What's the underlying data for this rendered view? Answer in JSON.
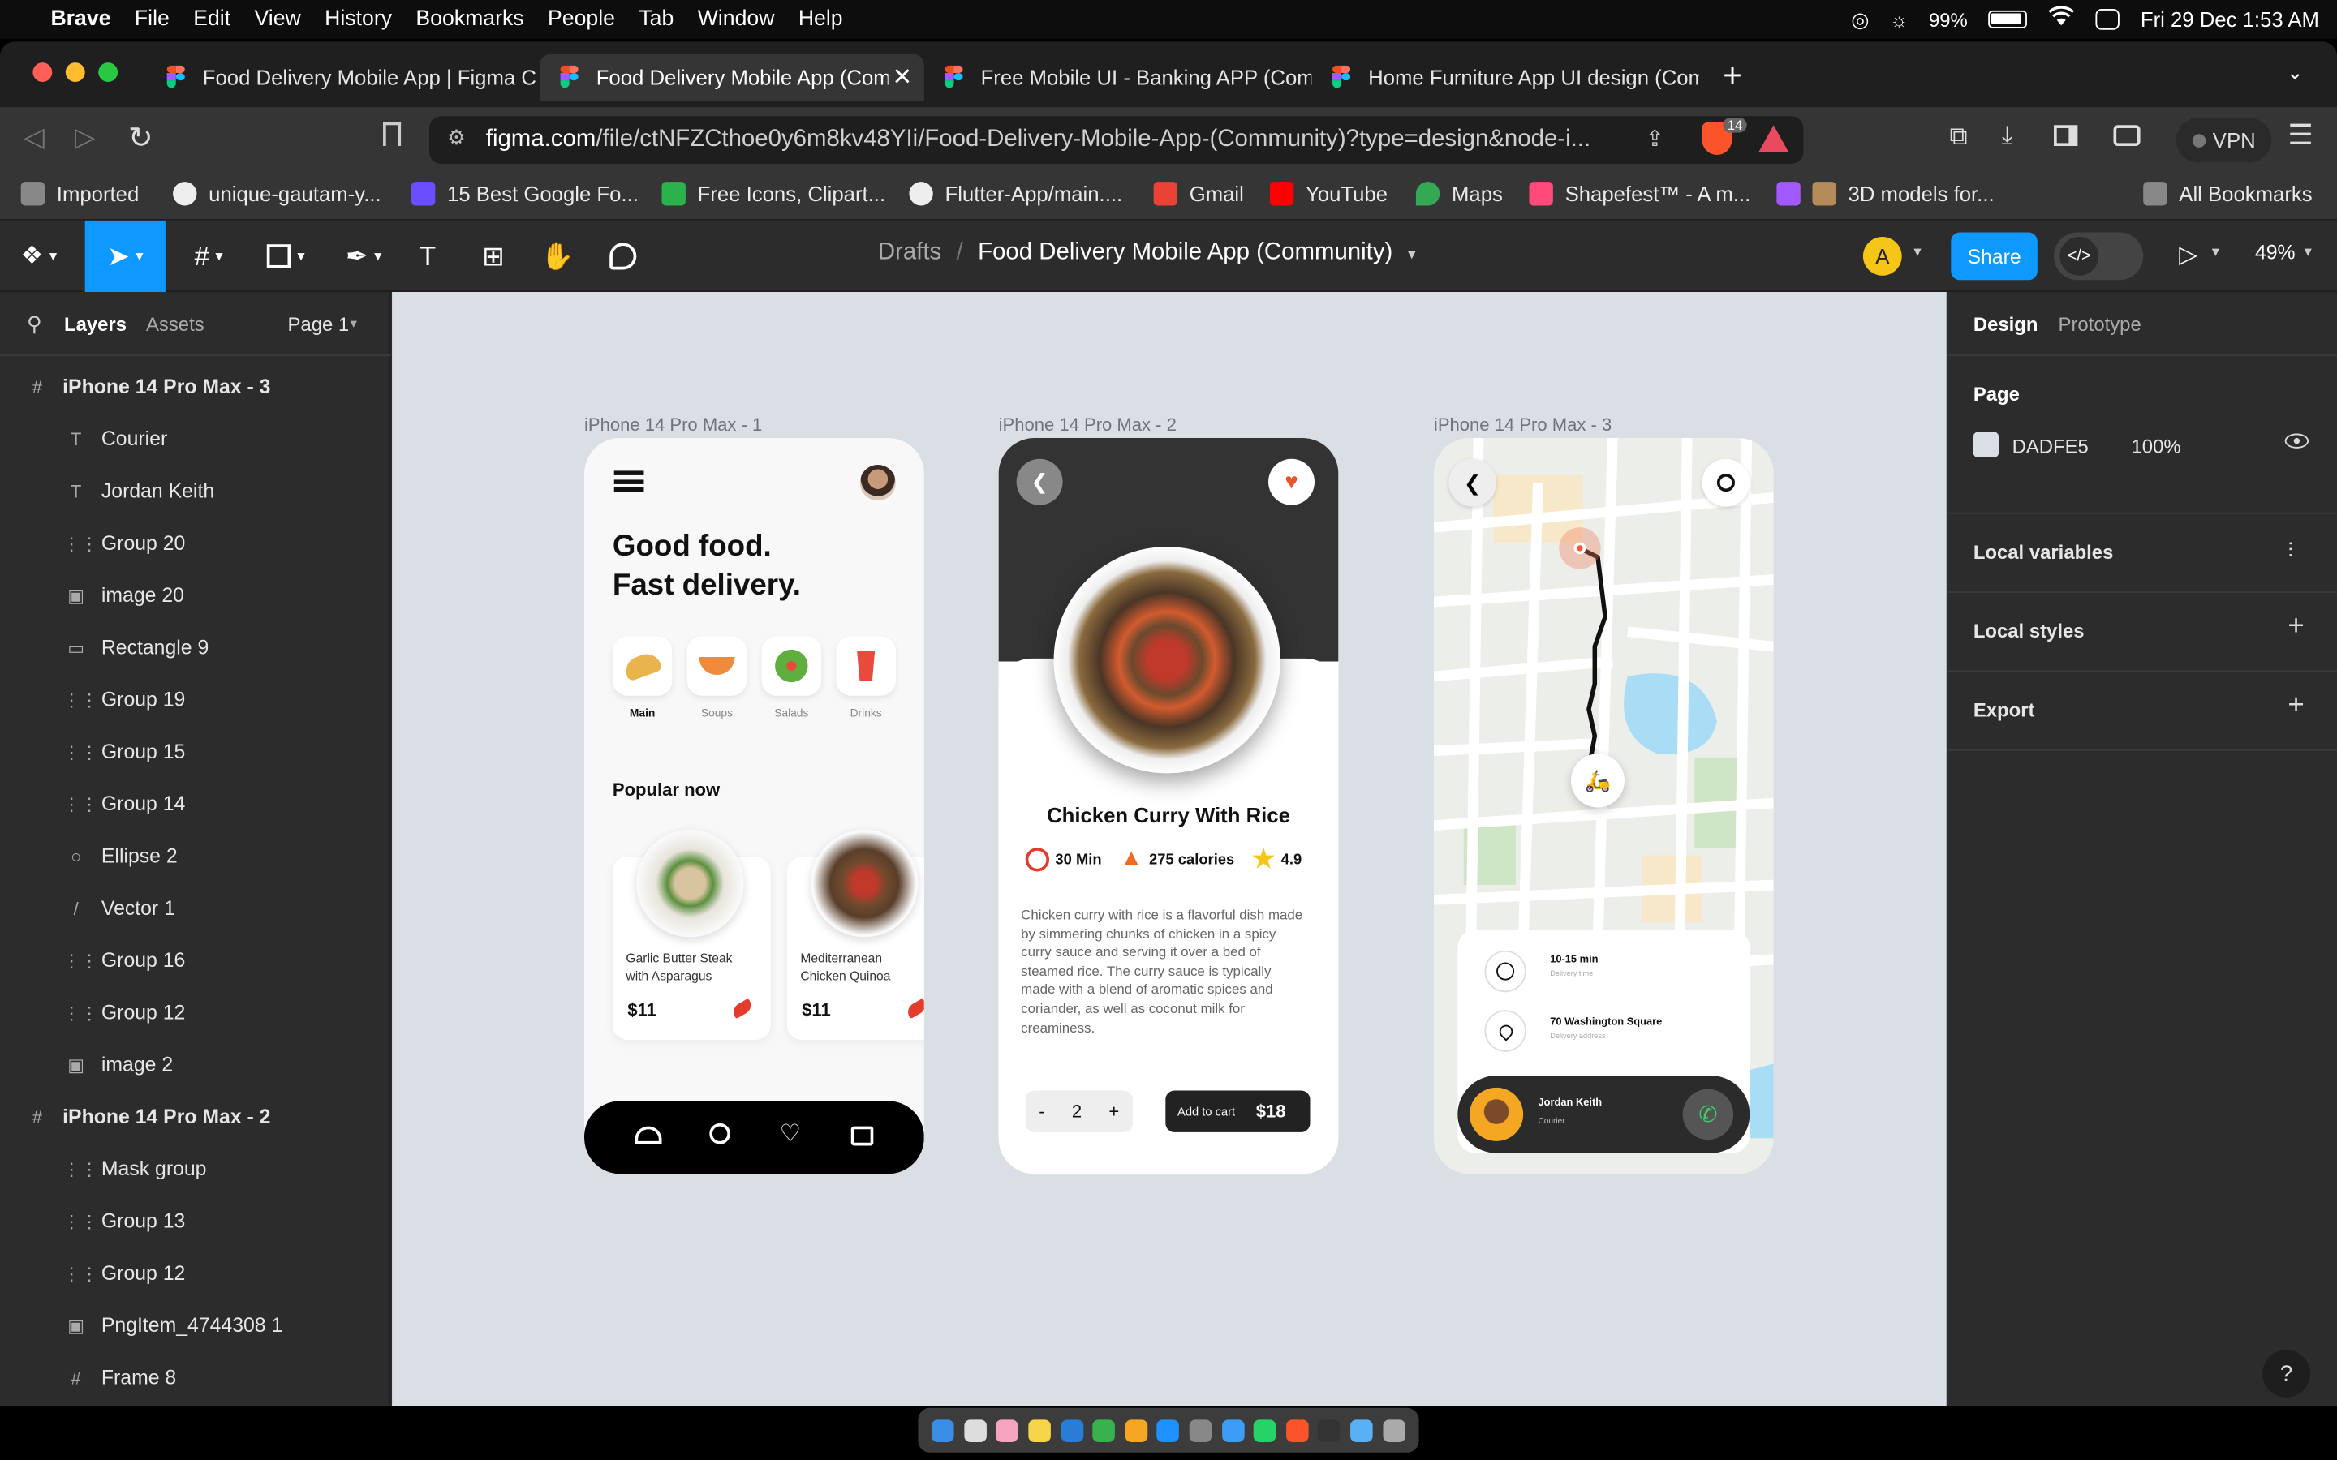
{
  "menubar": {
    "app": "Brave",
    "items": [
      "File",
      "Edit",
      "View",
      "History",
      "Bookmarks",
      "People",
      "Tab",
      "Window",
      "Help"
    ],
    "battery": "99%",
    "datetime": "Fri 29 Dec  1:53 AM"
  },
  "tabs": [
    "Food Delivery Mobile App | Figma C",
    "Food Delivery Mobile App (Com",
    "Free Mobile UI - Banking APP (Com",
    "Home Furniture App UI design (Com"
  ],
  "address": {
    "domain": "figma.com",
    "path": "/file/ctNFZCthoe0y6m8kv48YIi/Food-Delivery-Mobile-App-(Community)?type=design&node-i...",
    "vpn": "VPN",
    "brave_count": "14"
  },
  "bookmarks": [
    "Imported",
    "unique-gautam-y...",
    "15 Best Google Fo...",
    "Free Icons, Clipart...",
    "Flutter-App/main....",
    "Gmail",
    "YouTube",
    "Maps",
    "Shapefest™ - A m...",
    "3D models for..."
  ],
  "all_bookmarks": "All Bookmarks",
  "figma": {
    "breadcrumb_parent": "Drafts",
    "breadcrumb_sep": "/",
    "file_name": "Food Delivery Mobile App (Community)",
    "avatar": "A",
    "share": "Share",
    "zoom": "49%"
  },
  "left_panel": {
    "tab_layers": "Layers",
    "tab_assets": "Assets",
    "page": "Page 1",
    "layers": [
      {
        "name": "iPhone 14 Pro Max - 3",
        "icon": "#",
        "frame": true
      },
      {
        "name": "Courier",
        "icon": "T"
      },
      {
        "name": "Jordan Keith",
        "icon": "T"
      },
      {
        "name": "Group 20",
        "icon": "⋮⋮"
      },
      {
        "name": "image 20",
        "icon": "▣"
      },
      {
        "name": "Rectangle 9",
        "icon": "▭"
      },
      {
        "name": "Group 19",
        "icon": "⋮⋮"
      },
      {
        "name": "Group 15",
        "icon": "⋮⋮"
      },
      {
        "name": "Group 14",
        "icon": "⋮⋮"
      },
      {
        "name": "Ellipse 2",
        "icon": "○"
      },
      {
        "name": "Vector 1",
        "icon": "/"
      },
      {
        "name": "Group 16",
        "icon": "⋮⋮"
      },
      {
        "name": "Group 12",
        "icon": "⋮⋮"
      },
      {
        "name": "image 2",
        "icon": "▣"
      },
      {
        "name": "iPhone 14 Pro Max - 2",
        "icon": "#",
        "frame": true
      },
      {
        "name": "Mask group",
        "icon": "⋮⋮"
      },
      {
        "name": "Group 13",
        "icon": "⋮⋮"
      },
      {
        "name": "Group 12",
        "icon": "⋮⋮"
      },
      {
        "name": "PngItem_4744308 1",
        "icon": "▣"
      },
      {
        "name": "Frame 8",
        "icon": "#"
      }
    ]
  },
  "right_panel": {
    "tab_design": "Design",
    "tab_prototype": "Prototype",
    "page_label": "Page",
    "page_color": "DADFE5",
    "page_opacity": "100%",
    "local_variables": "Local variables",
    "local_styles": "Local styles",
    "export": "Export",
    "help": "?"
  },
  "frames": {
    "f1": "iPhone 14 Pro Max - 1",
    "f2": "iPhone 14 Pro Max - 2",
    "f3": "iPhone 14 Pro Max - 3"
  },
  "screen1": {
    "headline1": "Good food.",
    "headline2": "Fast delivery.",
    "categories": [
      "Main",
      "Soups",
      "Salads",
      "Drinks"
    ],
    "popular": "Popular now",
    "card1": {
      "name1": "Garlic Butter Steak",
      "name2": "with Asparagus",
      "price": "$11"
    },
    "card2": {
      "name1": "Mediterranean",
      "name2": "Chicken Quinoa",
      "price": "$11"
    }
  },
  "screen2": {
    "title": "Chicken Curry With Rice",
    "time": "30 Min",
    "calories": "275 calories",
    "rating": "4.9",
    "desc": "Chicken curry with rice is a flavorful dish made by simmering chunks of chicken in a spicy curry sauce and serving it over a bed of steamed rice. The curry sauce is typically made with a blend of aromatic spices and coriander, as well as coconut milk for creaminess.",
    "minus": "-",
    "qty": "2",
    "plus": "+",
    "add_to_cart": "Add to cart",
    "price": "$18"
  },
  "screen3": {
    "time": "10-15 min",
    "time_label": "Delivery time",
    "address": "70 Washington Square",
    "address_label": "Delivery address",
    "courier_name": "Jordan Keith",
    "courier_role": "Courier"
  }
}
